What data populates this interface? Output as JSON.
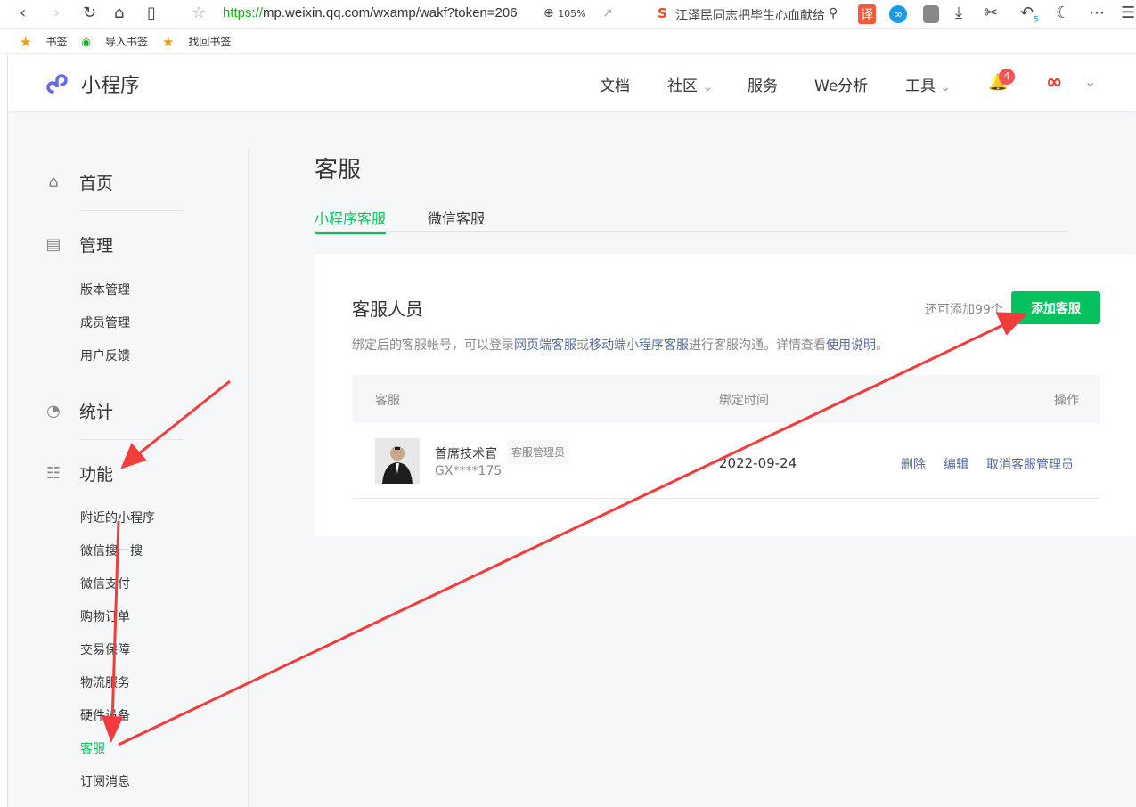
{
  "browser": {
    "url_scheme": "https://",
    "url_rest": "mp.weixin.qq.com/wxamp/wakf?token=206",
    "zoom": "105%",
    "search_text": "江泽民同志把毕生心血献给",
    "translate_icon_label": "译",
    "undo_count": "5",
    "bookmarks": [
      "书签",
      "导入书签",
      "找回书签"
    ]
  },
  "header": {
    "logo": "小程序",
    "nav": [
      "文档",
      "社区",
      "服务",
      "We分析",
      "工具"
    ],
    "notification_count": "4"
  },
  "sidebar": {
    "home": "首页",
    "manage": {
      "label": "管理",
      "items": [
        "版本管理",
        "成员管理",
        "用户反馈"
      ]
    },
    "stats": "统计",
    "features": {
      "label": "功能",
      "items": [
        "附近的小程序",
        "微信搜一搜",
        "微信支付",
        "购物订单",
        "交易保障",
        "物流服务",
        "硬件设备",
        "客服",
        "订阅消息"
      ],
      "active": "客服"
    }
  },
  "main": {
    "title": "客服",
    "tabs": [
      "小程序客服",
      "微信客服"
    ],
    "card": {
      "title": "客服人员",
      "remaining": "还可添加99个",
      "add_button": "添加客服",
      "desc": {
        "t1": "绑定后的客服帐号，可以登录",
        "l1": "网页端客服",
        "t2": "或",
        "l2": "移动端小程序客服",
        "t3": "进行客服沟通。详情查看",
        "l3": "使用说明",
        "t4": "。"
      },
      "columns": [
        "客服",
        "绑定时间",
        "操作"
      ],
      "rows": [
        {
          "name": "首席技术官",
          "role": "客服管理员",
          "account": "GX****175",
          "date": "2022-09-24",
          "actions": [
            "删除",
            "编辑",
            "取消客服管理员"
          ]
        }
      ]
    }
  },
  "colors": {
    "accent": "#07c160",
    "link": "#576b95",
    "annotation": "#f33c3c"
  }
}
